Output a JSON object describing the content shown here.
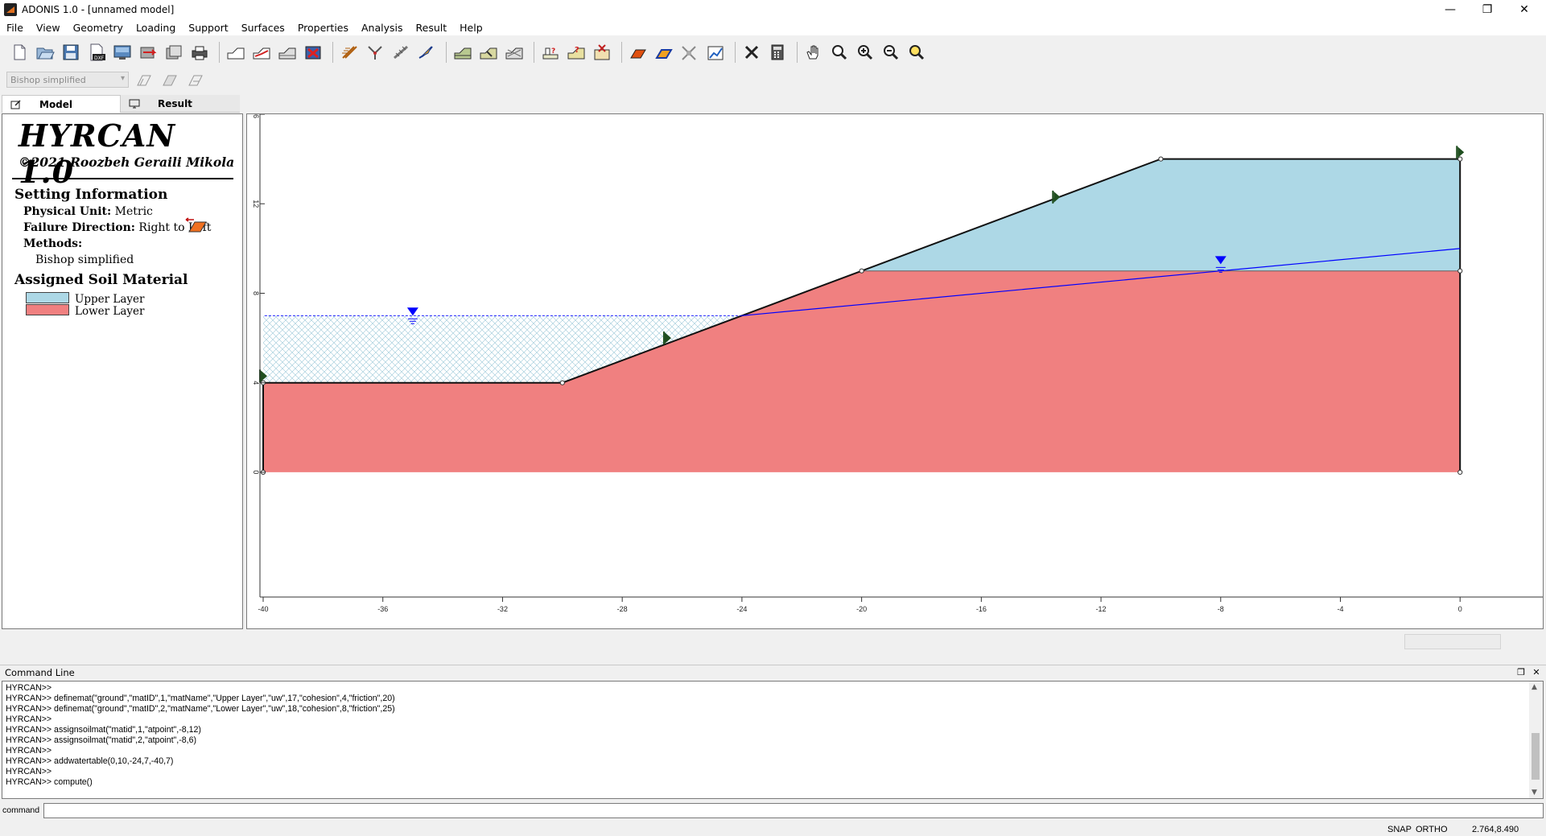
{
  "window": {
    "title": "ADONIS 1.0 - [unnamed model]",
    "minimize": "—",
    "restore": "❐",
    "close": "✕"
  },
  "menu": [
    "File",
    "View",
    "Geometry",
    "Loading",
    "Support",
    "Surfaces",
    "Properties",
    "Analysis",
    "Result",
    "Help"
  ],
  "toolbar2": {
    "method_value": "Bishop simplified"
  },
  "tabs": {
    "model": "Model",
    "result": "Result"
  },
  "panel": {
    "title": "HYRCAN 1.0",
    "copyright": "©2021 Roozbeh Geraili Mikola",
    "setting_heading": "Setting Information",
    "physical_unit_label": "Physical Unit:",
    "physical_unit_value": "Metric",
    "failure_dir_label": "Failure Direction:",
    "failure_dir_value": "Right to Left",
    "methods_label": "Methods:",
    "methods_value": "Bishop simplified",
    "soil_heading": "Assigned Soil Material",
    "materials": [
      {
        "name": "Upper Layer",
        "color": "#add8e6"
      },
      {
        "name": "Lower Layer",
        "color": "#f08080"
      }
    ]
  },
  "chart_data": {
    "type": "diagram",
    "xlim": [
      -40,
      2.764
    ],
    "ylim": [
      -1.8,
      16.0
    ],
    "x_ticks": [
      "-40",
      "-36",
      "-32",
      "-28",
      "-24",
      "-20",
      "-16",
      "-12",
      "-8",
      "-4",
      "0"
    ],
    "y_ticks": [
      "0",
      "4",
      "8",
      "12",
      "16"
    ],
    "upper_layer_polygon": [
      [
        -20,
        9
      ],
      [
        -10,
        14
      ],
      [
        0,
        14
      ],
      [
        0,
        9
      ]
    ],
    "lower_layer_polygon": [
      [
        -40,
        0
      ],
      [
        -40,
        4
      ],
      [
        -30,
        4
      ],
      [
        -20,
        9
      ],
      [
        0,
        9
      ],
      [
        0,
        0
      ]
    ],
    "boundary": [
      [
        -40,
        0
      ],
      [
        -40,
        4
      ],
      [
        -30,
        4
      ],
      [
        -20,
        9
      ],
      [
        -10,
        14
      ],
      [
        0,
        14
      ],
      [
        0,
        0
      ]
    ],
    "vertices": [
      [
        -40,
        0
      ],
      [
        -40,
        4
      ],
      [
        -30,
        4
      ],
      [
        -20,
        9
      ],
      [
        -10,
        14
      ],
      [
        0,
        14
      ],
      [
        0,
        9
      ],
      [
        0,
        0
      ]
    ],
    "layer_interface": [
      [
        -20,
        9
      ],
      [
        0,
        9
      ]
    ],
    "water_table": [
      [
        0,
        10
      ],
      [
        -24,
        7
      ],
      [
        -40,
        7
      ]
    ],
    "ponded_water": [
      [
        -40,
        7
      ],
      [
        -24,
        7
      ],
      [
        -30,
        4
      ],
      [
        -40,
        4
      ]
    ],
    "water_markers": [
      [
        -35,
        7
      ],
      [
        -8,
        9.3
      ]
    ],
    "boundary_markers": [
      [
        -40,
        4.3
      ],
      [
        -26.5,
        6
      ],
      [
        -13.5,
        12.3
      ],
      [
        0,
        14.3
      ]
    ],
    "colors": {
      "upper": "#add8e6",
      "lower": "#f08080",
      "water": "#0000ff",
      "marker": "#1f4e1f"
    }
  },
  "command": {
    "header": "Command Line",
    "prompt_label": "command",
    "lines": [
      "HYRCAN>>",
      "HYRCAN>> definemat(\"ground\",\"matID\",1,\"matName\",\"Upper Layer\",\"uw\",17,\"cohesion\",4,\"friction\",20)",
      "HYRCAN>> definemat(\"ground\",\"matID\",2,\"matName\",\"Lower Layer\",\"uw\",18,\"cohesion\",8,\"friction\",25)",
      "HYRCAN>>",
      "HYRCAN>> assignsoilmat(\"matid\",1,\"atpoint\",-8,12)",
      "HYRCAN>> assignsoilmat(\"matid\",2,\"atpoint\",-8,6)",
      "HYRCAN>>",
      "HYRCAN>> addwatertable(0,10,-24,7,-40,7)",
      "HYRCAN>>",
      "HYRCAN>> compute()"
    ]
  },
  "status": {
    "snap": "SNAP",
    "ortho": "ORTHO",
    "coords": "2.764,8.490"
  }
}
